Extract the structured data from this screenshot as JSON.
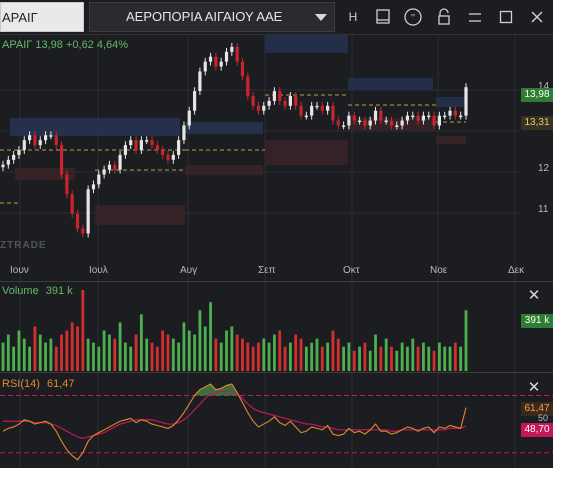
{
  "toolbar": {
    "symbol": "ΑΡΑΙΓ",
    "company_name": "ΑΕΡΟΠΟΡΙΑ ΑΙΓΑΙΟΥ ΑΑΕ",
    "h_label": "H"
  },
  "price_legend": {
    "symbol": "ΑΡΑΙΓ",
    "last": "13,98",
    "change": "+0,62",
    "change_pct": "4,64%"
  },
  "price_axis": {
    "labels": [
      "14",
      "13",
      "12",
      "11"
    ],
    "last_tag": "13,98",
    "avg_tag": "13,31"
  },
  "x_axis": {
    "labels": [
      "Ιουν",
      "Ιουλ",
      "Αυγ",
      "Σεπ",
      "Οκτ",
      "Νοε",
      "Δεκ"
    ]
  },
  "volume": {
    "label": "Volume",
    "value": "391 k",
    "tag": "391 k"
  },
  "rsi": {
    "label": "RSI(14)",
    "value": "61,47",
    "tag_rsi": "61,47",
    "tag_50": "50",
    "tag_ma": "48,70"
  },
  "watermark": "ZTRADE",
  "colors": {
    "bg": "#1c1d21",
    "up": "#e6e6e6",
    "down": "#c8242f",
    "vol_up": "#4caf50",
    "vol_down": "#d32f2f",
    "rsi": "#e08a2a",
    "rsi_ma": "#c2185b",
    "legend_green": "#63b86a"
  },
  "chart_data": [
    {
      "type": "candlestick",
      "title": "ΑΡΑΙΓ",
      "x_labels": [
        "Ιουν",
        "Ιουλ",
        "Αυγ",
        "Σεπ",
        "Οκτ",
        "Νοε",
        "Δεκ"
      ],
      "ylim": [
        10.5,
        14.9
      ],
      "y_ticks": [
        11,
        12,
        13,
        14
      ],
      "close": [
        12.4,
        12.5,
        12.6,
        12.7,
        12.9,
        13.0,
        12.8,
        12.9,
        13.0,
        13.0,
        12.8,
        12.2,
        11.8,
        11.4,
        11.1,
        11.0,
        11.9,
        12.0,
        12.2,
        12.3,
        12.4,
        12.3,
        12.6,
        12.8,
        12.9,
        12.7,
        12.9,
        12.9,
        12.8,
        12.7,
        12.6,
        12.5,
        12.6,
        12.9,
        13.2,
        13.5,
        13.9,
        14.3,
        14.5,
        14.6,
        14.4,
        14.5,
        14.7,
        14.8,
        14.5,
        14.2,
        13.8,
        13.6,
        13.5,
        13.6,
        13.7,
        13.9,
        13.7,
        13.6,
        13.8,
        13.6,
        13.4,
        13.4,
        13.6,
        13.6,
        13.5,
        13.6,
        13.3,
        13.2,
        13.2,
        13.4,
        13.3,
        13.3,
        13.2,
        13.3,
        13.5,
        13.3,
        13.3,
        13.2,
        13.2,
        13.3,
        13.4,
        13.4,
        13.3,
        13.4,
        13.4,
        13.2,
        13.4,
        13.4,
        13.5,
        13.4,
        13.4,
        13.98
      ],
      "last": 13.98
    },
    {
      "type": "bar",
      "title": "Volume",
      "values": [
        0.35,
        0.45,
        0.3,
        0.5,
        0.4,
        0.3,
        0.55,
        0.45,
        0.35,
        0.4,
        0.3,
        0.45,
        0.5,
        0.6,
        0.55,
        1.0,
        0.4,
        0.35,
        0.3,
        0.5,
        0.45,
        0.4,
        0.6,
        0.35,
        0.3,
        0.45,
        0.7,
        0.4,
        0.35,
        0.3,
        0.5,
        0.45,
        0.4,
        0.35,
        0.6,
        0.5,
        0.45,
        0.75,
        0.55,
        0.85,
        0.4,
        0.35,
        0.5,
        0.55,
        0.45,
        0.4,
        0.35,
        0.3,
        0.35,
        0.4,
        0.35,
        0.45,
        0.5,
        0.3,
        0.35,
        0.45,
        0.4,
        0.3,
        0.35,
        0.4,
        0.3,
        0.35,
        0.5,
        0.4,
        0.3,
        0.35,
        0.25,
        0.3,
        0.35,
        0.25,
        0.45,
        0.3,
        0.4,
        0.3,
        0.25,
        0.35,
        0.3,
        0.4,
        0.3,
        0.35,
        0.3,
        0.25,
        0.35,
        0.3,
        0.3,
        0.35,
        0.3,
        0.75
      ],
      "unit": "k",
      "last": 391
    },
    {
      "type": "line",
      "title": "RSI(14)",
      "ylim": [
        20,
        85
      ],
      "rsi": [
        45,
        47,
        48,
        50,
        53,
        52,
        50,
        51,
        52,
        50,
        45,
        38,
        32,
        28,
        25,
        30,
        38,
        42,
        44,
        46,
        48,
        50,
        52,
        53,
        54,
        51,
        53,
        52,
        50,
        49,
        48,
        47,
        49,
        53,
        58,
        64,
        70,
        74,
        76,
        78,
        74,
        75,
        77,
        78,
        72,
        65,
        58,
        52,
        48,
        50,
        52,
        55,
        51,
        49,
        52,
        48,
        44,
        45,
        48,
        47,
        46,
        49,
        43,
        42,
        43,
        47,
        44,
        45,
        43,
        46,
        50,
        45,
        45,
        43,
        44,
        46,
        48,
        47,
        45,
        47,
        48,
        44,
        48,
        47,
        49,
        48,
        47,
        61.47
      ],
      "rsi_ma": [
        52,
        52,
        52,
        52,
        52,
        52,
        51,
        51,
        51,
        50,
        49,
        47,
        45,
        43,
        41,
        40,
        41,
        42,
        43,
        44,
        46,
        48,
        50,
        51,
        52,
        53,
        53,
        53,
        53,
        52,
        51,
        50,
        50,
        51,
        53,
        56,
        60,
        64,
        68,
        71,
        72,
        73,
        73,
        73,
        71,
        68,
        64,
        61,
        59,
        58,
        57,
        56,
        55,
        54,
        53,
        52,
        51,
        50,
        50,
        49,
        48,
        48,
        47,
        46,
        46,
        46,
        46,
        46,
        46,
        46,
        46,
        46,
        46,
        45,
        45,
        46,
        46,
        46,
        46,
        46,
        46,
        46,
        46,
        46,
        47,
        47,
        47,
        48.7
      ],
      "last": 61.47,
      "ma_last": 48.7
    }
  ]
}
